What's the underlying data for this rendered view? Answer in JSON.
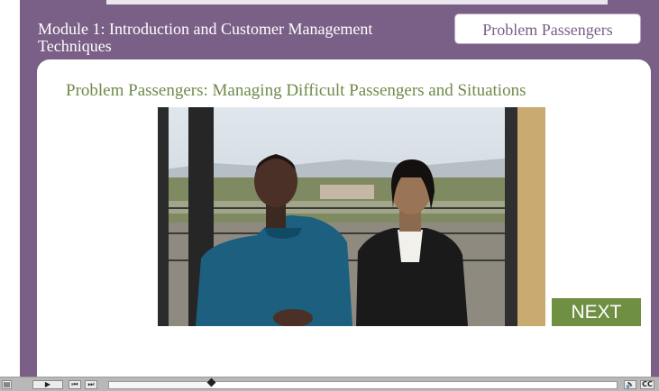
{
  "module": {
    "title": "Module 1: Introduction and Customer Management Techniques"
  },
  "section": {
    "badge": "Problem Passengers"
  },
  "content": {
    "heading": "Problem Passengers: Managing Difficult Passengers and Situations"
  },
  "nav": {
    "next_label": "NEXT"
  },
  "player": {
    "progress_fraction": 0.2,
    "cc_label": "CC",
    "icons": [
      "menu-icon",
      "play-icon",
      "skip-back-icon",
      "skip-forward-icon",
      "volume-icon",
      "closed-caption-icon"
    ]
  },
  "colors": {
    "frame": "#7a5f86",
    "heading_green": "#6f8a4a",
    "next_button": "#6f8f43"
  }
}
